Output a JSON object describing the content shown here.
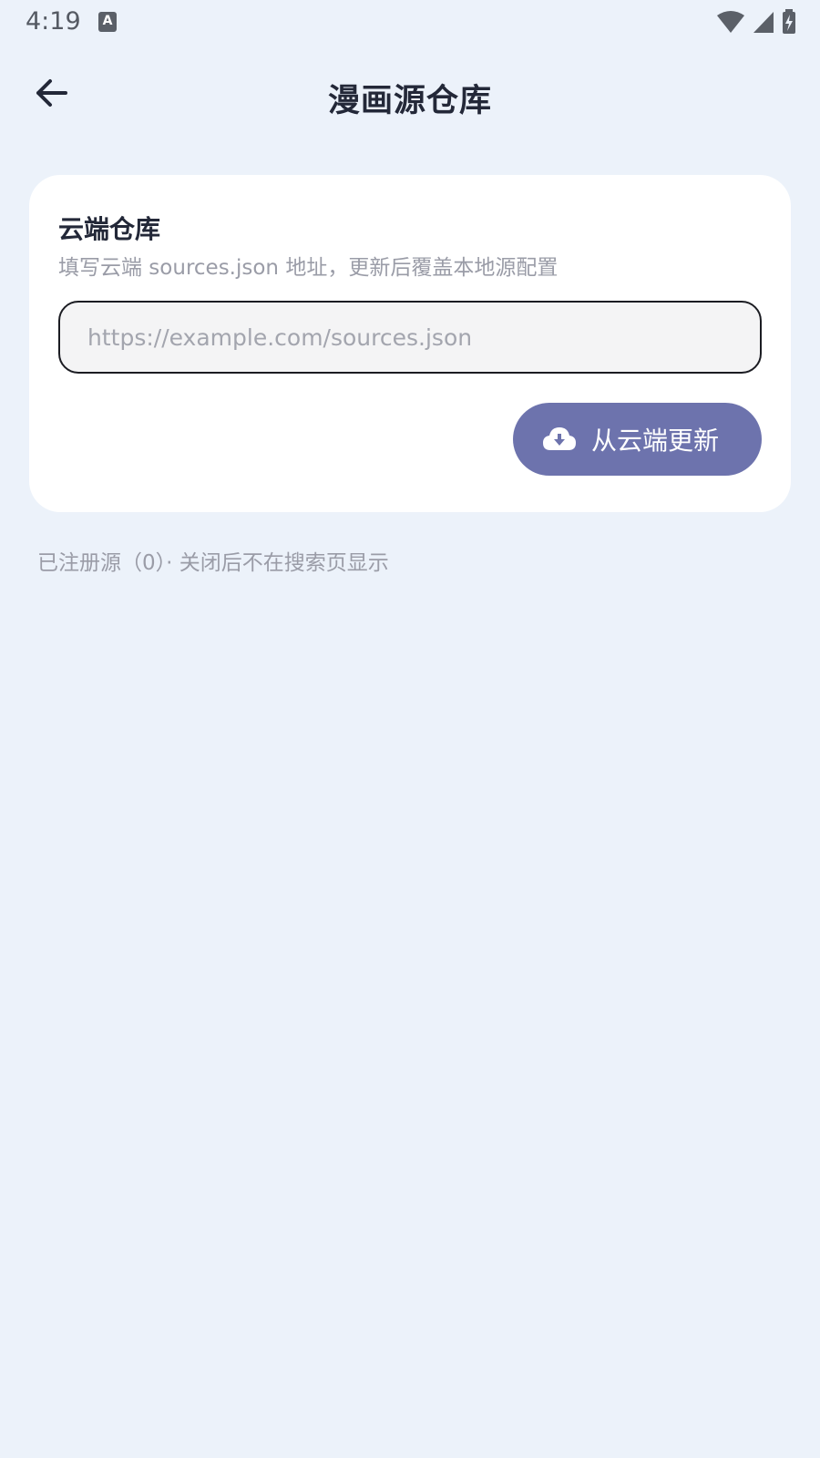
{
  "status_bar": {
    "time": "4:19",
    "notification_icon": "text-a-icon",
    "icons": [
      "wifi-icon",
      "cell-signal-icon",
      "battery-charging-icon"
    ]
  },
  "header": {
    "back_icon": "arrow-left-icon",
    "title": "漫画源仓库"
  },
  "cloud_repo": {
    "title": "云端仓库",
    "description": "填写云端 sources.json 地址，更新后覆盖本地源配置",
    "url_input": {
      "value": "",
      "placeholder": "https://example.com/sources.json"
    },
    "update_button": {
      "icon": "cloud-download-icon",
      "label": "从云端更新"
    }
  },
  "registered_info": "已注册源（0）· 关闭后不在搜索页显示",
  "colors": {
    "background": "#ecf2fa",
    "card": "#ffffff",
    "accent": "#6d73ad",
    "text_primary": "#232838",
    "text_secondary": "#9a9ca7"
  }
}
